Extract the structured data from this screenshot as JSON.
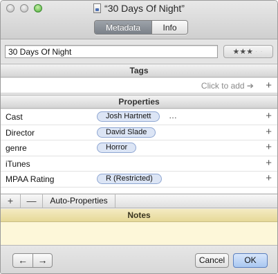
{
  "window": {
    "title": "“30 Days Of Night”"
  },
  "tabs": [
    {
      "label": "Metadata",
      "active": true
    },
    {
      "label": "Info",
      "active": false
    }
  ],
  "name_field": {
    "value": "30 Days Of Night"
  },
  "rating": {
    "filled_stars": 3,
    "max_stars": 5,
    "filled_glyph": "★★★",
    "empty_glyph": "·",
    "empty_glyph_2": "·"
  },
  "tags": {
    "header": "Tags",
    "click_to_add": "Click to add ➔",
    "plus_label": "+"
  },
  "properties": {
    "header": "Properties",
    "plus_label": "+",
    "rows": [
      {
        "key": "Cast",
        "value": "Josh Hartnett",
        "more": "…"
      },
      {
        "key": "Director",
        "value": "David Slade"
      },
      {
        "key": "genre",
        "value": "Horror"
      },
      {
        "key": "iTunes",
        "value": ""
      },
      {
        "key": "MPAA Rating",
        "value": "R (Restricted)"
      }
    ]
  },
  "bottom_bar": {
    "add_label": "+",
    "remove_label": "—",
    "auto_properties_label": "Auto-Properties"
  },
  "notes": {
    "header": "Notes",
    "content": ""
  },
  "footer": {
    "back_label": "←",
    "forward_label": "→",
    "cancel_label": "Cancel",
    "ok_label": "OK"
  },
  "colors": {
    "pill_fill": "#dce5f5",
    "pill_border": "#8ea6d2",
    "notes_background": "#fdf7d9",
    "ok_button": "#a9c7f0",
    "zoom_button": "#4fae3a"
  },
  "icons": [
    "close-window-icon",
    "minimize-window-icon",
    "zoom-window-icon",
    "document-icon",
    "arrow-right-icon",
    "plus-icon",
    "minus-icon",
    "arrow-left-icon"
  ]
}
